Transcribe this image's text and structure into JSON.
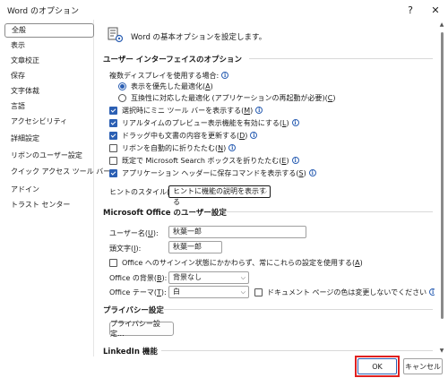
{
  "window": {
    "title": "Word のオプション",
    "help_glyph": "?",
    "close_glyph": "✕"
  },
  "sidebar": {
    "items": [
      {
        "label": "全般",
        "active": true
      },
      {
        "label": "表示"
      },
      {
        "label": "文章校正"
      },
      {
        "label": "保存"
      },
      {
        "label": "文字体裁"
      },
      {
        "label": "言語"
      },
      {
        "label": "アクセシビリティ"
      },
      {
        "label": "詳細設定"
      },
      {
        "label": "リボンのユーザー設定"
      },
      {
        "label": "クイック アクセス ツール バー"
      },
      {
        "label": "アドイン"
      },
      {
        "label": "トラスト センター"
      }
    ]
  },
  "main": {
    "header_text": "Word の基本オプションを設定します。",
    "ui_section": {
      "title": "ユーザー インターフェイスのオプション",
      "multi_display_label": "複数ディスプレイを使用する場合:",
      "radio1_pre": "表示を優先した最適化(",
      "radio1_key": "A",
      "radio1_post": ")",
      "radio2_pre": "互換性に対応した最適化 (アプリケーションの再起動が必要)(",
      "radio2_key": "C",
      "radio2_post": ")",
      "opt1_pre": "選択時にミニ ツール バーを表示する(",
      "opt1_key": "M",
      "opt1_post": ")",
      "opt2_pre": "リアルタイムのプレビュー表示機能を有効にする(",
      "opt2_key": "L",
      "opt2_post": ")",
      "opt3_pre": "ドラッグ中も文書の内容を更新する(",
      "opt3_key": "D",
      "opt3_post": ")",
      "opt4_pre": "リボンを自動的に折りたたむ(",
      "opt4_key": "N",
      "opt4_post": ")",
      "opt5_pre": "既定で Microsoft Search ボックスを折りたたむ(",
      "opt5_key": "E",
      "opt5_post": ")",
      "opt6_pre": "アプリケーション ヘッダーに保存コマンドを表示する(",
      "opt6_key": "S",
      "opt6_post": ")",
      "tooltip_label_pre": "ヒントのスタイル(",
      "tooltip_label_key": "R",
      "tooltip_label_post": "):",
      "tooltip_value": "ヒントに機能の説明を表示する"
    },
    "personalize_section": {
      "title": "Microsoft Office のユーザー設定",
      "username_label_pre": "ユーザー名(",
      "username_label_key": "U",
      "username_label_post": "):",
      "username_value": "秋葉一郎",
      "initials_label_pre": "頭文字(",
      "initials_label_key": "I",
      "initials_label_post": "):",
      "initials_value": "秋葉一郎",
      "always_use_pre": "Office へのサインイン状態にかかわらず、常にこれらの設定を使用する(",
      "always_use_key": "A",
      "always_use_post": ")",
      "background_label_pre": "Office の背景(",
      "background_label_key": "B",
      "background_label_post": "):",
      "background_value": "背景なし",
      "theme_label_pre": "Office テーマ(",
      "theme_label_key": "T",
      "theme_label_post": "):",
      "theme_value": "白",
      "doc_color_label": "ドキュメント ページの色は変更しないでください"
    },
    "privacy_section": {
      "title": "プライバシー設定",
      "button_label": "プライバシー設定..."
    },
    "linkedin_section": {
      "title": "LinkedIn 機能"
    }
  },
  "footer": {
    "ok_label": "OK",
    "cancel_label": "キャンセル"
  },
  "colors": {
    "accent": "#2b5fb3",
    "highlight": "#e02020"
  }
}
